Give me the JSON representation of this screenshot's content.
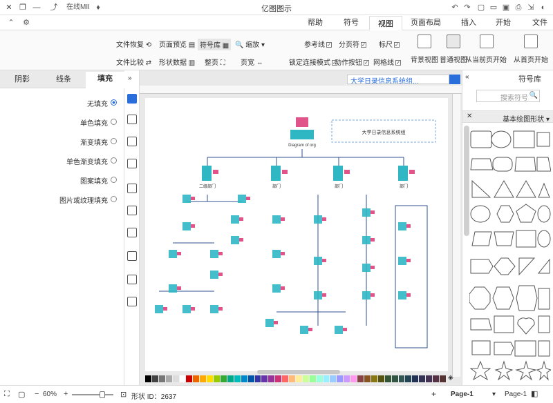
{
  "window": {
    "title": "亿图图示"
  },
  "menu": {
    "tabs": [
      "文件",
      "开始",
      "插入",
      "页面布局",
      "视图",
      "符号",
      "帮助"
    ],
    "active": "视图"
  },
  "topbar": {
    "account": "在线MII",
    "share": "分享"
  },
  "ribbon": {
    "from_first": "从首页开始",
    "from_current": "从当前页开始",
    "normal_view": "普通视图",
    "bg_view": "背景视图",
    "show_ruler": "标尺",
    "show_grid": "网格线",
    "show_pagebreak": "分页符",
    "show_snap": "动作按钮",
    "guide": "参考线",
    "connect_points": "锁定连接模式",
    "zoom": "缩放",
    "page_width": "页宽",
    "page_fit": "整页",
    "symbol_lib": "符号库",
    "page_preview": "页面预览",
    "shape_data": "形状数据",
    "file_recovery": "文件恢复",
    "file_compare": "文件比较"
  },
  "left_panel": {
    "tabs": [
      "填充",
      "线条",
      "阴影"
    ],
    "active_tab": "填充",
    "options": [
      "无填充",
      "单色填充",
      "渐变填充",
      "单色渐变填充",
      "图案填充",
      "图片或纹理填充"
    ],
    "selected": "无填充"
  },
  "right_panel": {
    "header": "符号库",
    "search_placeholder": "搜索符号",
    "category": "基本绘图形状"
  },
  "canvas": {
    "doc_tab": "大学日录信息系统组..."
  },
  "chart": {
    "root": "Diagram of org",
    "note": "大学日录信息系统组",
    "branches": [
      "二级部门",
      "部门",
      "部门",
      "部门"
    ]
  },
  "status": {
    "page_label": "Page-1",
    "page_selector": "Page-1",
    "shape_id": "形状 ID：2637",
    "zoom": "60%"
  },
  "colors": {
    "accent": "#2a6edc",
    "canvas_bg": "#ffffff",
    "node_teal": "#2fb7c4",
    "node_pink": "#e0548a"
  }
}
